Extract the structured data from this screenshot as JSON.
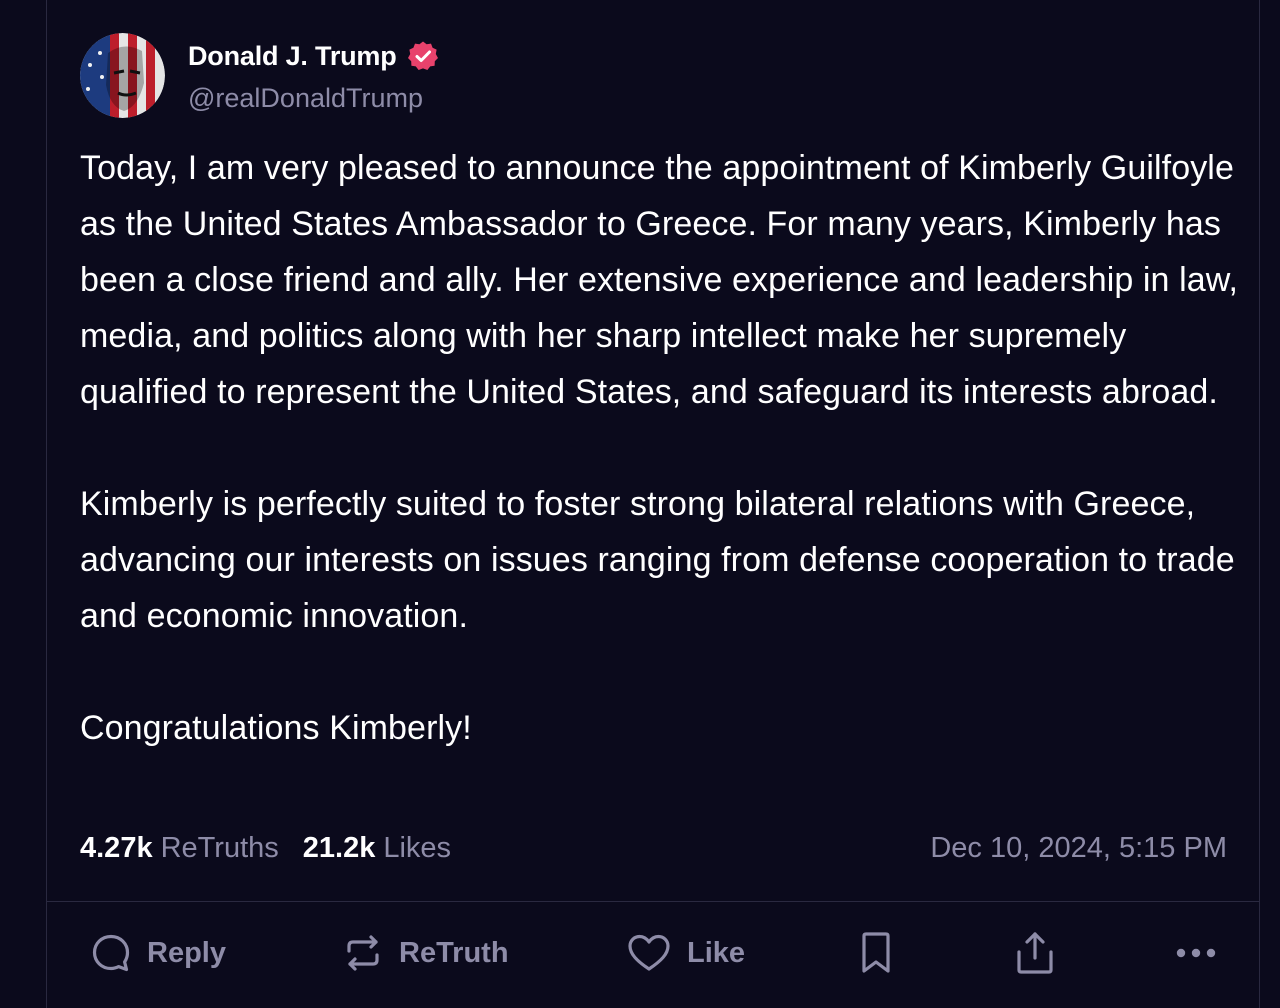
{
  "account": {
    "display_name": "Donald J. Trump",
    "handle": "@realDonaldTrump",
    "verified_icon": "verified-badge-icon",
    "verified_color": "#e8426c"
  },
  "post": {
    "paragraphs": [
      "Today, I am very pleased to announce the appointment of Kimberly Guilfoyle as the United States Ambassador to Greece. For many years, Kimberly has been a close friend and ally. Her extensive experience and leadership in law, media, and politics along with her sharp intellect make her supremely qualified to represent the United States, and safeguard its interests abroad.",
      "Kimberly is perfectly suited to foster strong bilateral relations with Greece, advancing our interests on issues ranging from defense cooperation to trade and economic innovation.",
      "Congratulations Kimberly!"
    ]
  },
  "stats": {
    "retruths_count": "4.27k",
    "retruths_label": "ReTruths",
    "likes_count": "21.2k",
    "likes_label": "Likes"
  },
  "timestamp": "Dec 10, 2024, 5:15 PM",
  "actions": {
    "reply_label": "Reply",
    "retruth_label": "ReTruth",
    "like_label": "Like",
    "icons": [
      "reply-icon",
      "retruth-icon",
      "like-icon",
      "bookmark-icon",
      "share-icon",
      "more-icon"
    ]
  },
  "theme": {
    "background": "#0b0a1c",
    "text": "#ffffff",
    "muted": "#8e8ca8",
    "border": "#2a2940"
  }
}
